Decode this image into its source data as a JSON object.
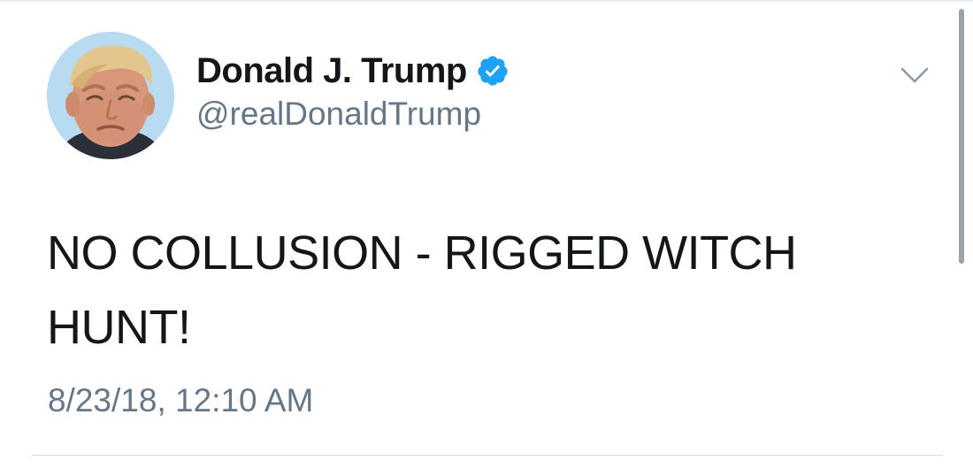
{
  "tweet": {
    "display_name": "Donald J. Trump",
    "handle": "@realDonaldTrump",
    "verified": true,
    "text": "NO COLLUSION - RIGGED WITCH HUNT!",
    "timestamp": "8/23/18, 12:10 AM"
  },
  "icons": {
    "verified": "verified-badge-icon",
    "menu": "chevron-down-icon"
  },
  "colors": {
    "text": "#14171a",
    "secondary": "#657786",
    "verified_blue": "#1da1f2",
    "divider": "#e6ecf0"
  }
}
